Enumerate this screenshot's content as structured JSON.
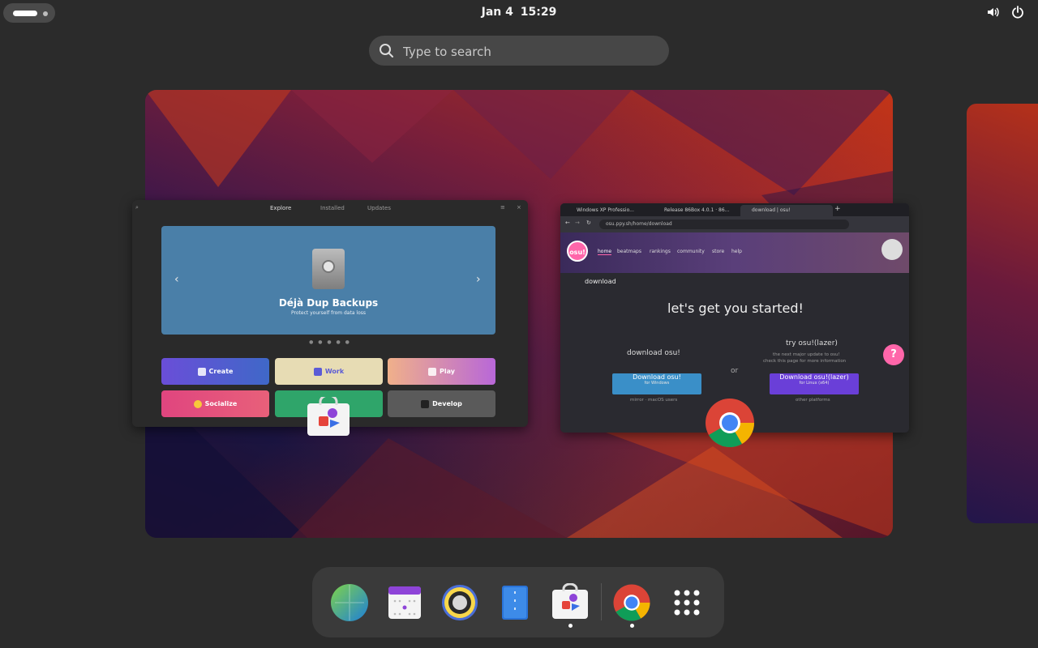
{
  "topbar": {
    "date": "Jan 4",
    "time": "15:29",
    "icons": [
      "volume-icon",
      "power-icon"
    ]
  },
  "search": {
    "placeholder": "Type to search"
  },
  "software_window": {
    "tabs": [
      {
        "label": "Explore",
        "active": true
      },
      {
        "label": "Installed",
        "active": false
      },
      {
        "label": "Updates",
        "active": false
      }
    ],
    "banner": {
      "title": "Déjà Dup Backups",
      "subtitle": "Protect yourself from data loss",
      "color": "#4a7fa8"
    },
    "categories": [
      {
        "label": "Create",
        "color": "#5b5bd6"
      },
      {
        "label": "Work",
        "color": "#e7dcb4"
      },
      {
        "label": "Play",
        "color": "#d98fb8"
      },
      {
        "label": "Socialize",
        "color": "#e0457f"
      },
      {
        "label": "",
        "color": "#2fa56a"
      },
      {
        "label": "Develop",
        "color": "#5a5a5a"
      }
    ]
  },
  "chrome_window": {
    "tabs": [
      {
        "label": "Windows XP Professio...",
        "active": false
      },
      {
        "label": "Release 86Box 4.0.1 · 86...",
        "active": false
      },
      {
        "label": "download | osu!",
        "active": true
      }
    ],
    "url": "osu.ppy.sh/home/download",
    "osu": {
      "logo": "osu!",
      "nav": [
        "home",
        "beatmaps",
        "rankings",
        "community",
        "store",
        "help"
      ],
      "section": "download",
      "headline": "let's get you started!",
      "left_label": "download osu!",
      "left_button": "Download osu!",
      "left_button_sub": "for Windows",
      "left_links": "mirror · macOS users",
      "or_text": "or",
      "right_label": "try osu!(lazer)",
      "right_desc": "the next major update to osu!",
      "right_desc2": "check this page for more information",
      "right_button": "Download osu!(lazer)",
      "right_button_sub": "for Linux (x64)",
      "right_links": "other platforms",
      "help": "?",
      "pink": "#ff66aa"
    }
  },
  "dock": {
    "items": [
      {
        "name": "web-browser-icon",
        "running": false
      },
      {
        "name": "calendar-icon",
        "running": false
      },
      {
        "name": "music-player-icon",
        "running": false
      },
      {
        "name": "text-editor-icon",
        "running": false
      },
      {
        "name": "software-store-icon",
        "running": true
      },
      {
        "name": "chrome-icon",
        "running": true
      },
      {
        "name": "app-grid-icon",
        "running": false
      }
    ]
  }
}
